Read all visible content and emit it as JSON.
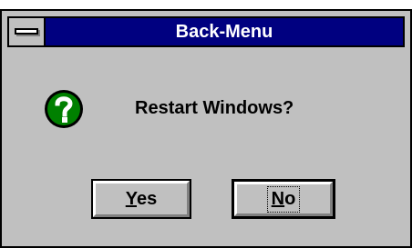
{
  "window": {
    "title": "Back-Menu",
    "system_menu_icon": "system-menu-icon"
  },
  "dialog": {
    "icon": "question-icon",
    "icon_color": "#008000",
    "message": "Restart Windows?"
  },
  "buttons": {
    "yes": {
      "mnemonic": "Y",
      "rest": "es"
    },
    "no": {
      "mnemonic": "N",
      "rest": "o"
    }
  }
}
